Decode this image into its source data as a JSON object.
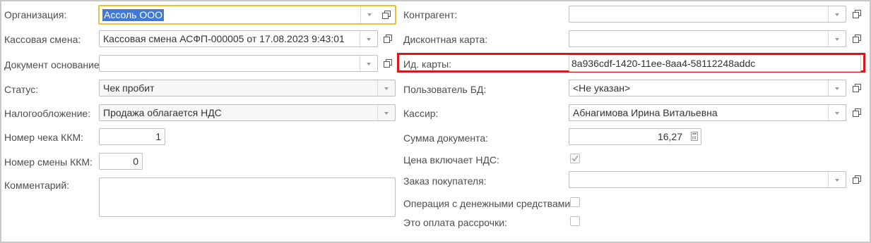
{
  "left": {
    "organization": {
      "label": "Организация:",
      "value": "Ассоль ООО"
    },
    "cash_shift": {
      "label": "Кассовая смена:",
      "value": "Кассовая смена АСФП-000005 от 17.08.2023 9:43:01"
    },
    "base_document": {
      "label": "Документ основание:",
      "value": ""
    },
    "status": {
      "label": "Статус:",
      "value": "Чек пробит"
    },
    "taxation": {
      "label": "Налогообложение:",
      "value": "Продажа облагается НДС"
    },
    "receipt_number": {
      "label": "Номер чека ККМ:",
      "value": "1"
    },
    "shift_number": {
      "label": "Номер смены ККМ:",
      "value": "0"
    },
    "comment": {
      "label": "Комментарий:",
      "value": ""
    }
  },
  "right": {
    "counterparty": {
      "label": "Контрагент:",
      "value": ""
    },
    "discount_card": {
      "label": "Дисконтная карта:",
      "value": ""
    },
    "card_id": {
      "label": "Ид. карты:",
      "value": "8a936cdf-1420-11ee-8aa4-58112248addc"
    },
    "db_user": {
      "label": "Пользователь БД:",
      "value": "<Не указан>"
    },
    "cashier": {
      "label": "Кассир:",
      "value": "Абнагимова Ирина Витальевна"
    },
    "doc_sum": {
      "label": "Сумма документа:",
      "value": "16,27"
    },
    "price_incl_vat": {
      "label": "Цена включает НДС:",
      "checked": true
    },
    "customer_order": {
      "label": "Заказ покупателя:",
      "value": ""
    },
    "cash_operation": {
      "label": "Операция с денежными средствами:",
      "checked": false
    },
    "installment": {
      "label": "Это оплата рассрочки:",
      "checked": false
    }
  },
  "colors": {
    "highlight_border": "#d9161c",
    "focus_border": "#e8c23a",
    "selection": "#3e7ad6"
  }
}
